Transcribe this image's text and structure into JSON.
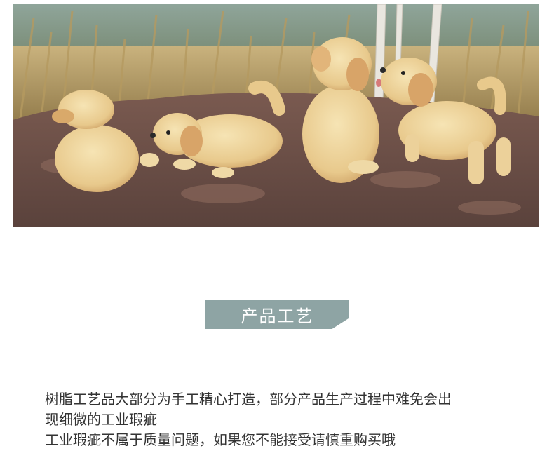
{
  "section": {
    "title": "产品工艺"
  },
  "notes": {
    "line1": "树脂工艺品大部分为手工精心打造，部分产品生产过程中难免会出",
    "line2": "现细微的工业瑕疵",
    "line3": "工业瑕疵不属于质量问题，如果您不能接受请慎重购买哦"
  },
  "colors": {
    "tag_background": "#8ea4a4",
    "rule": "#8aa3a1",
    "text": "#333333"
  }
}
